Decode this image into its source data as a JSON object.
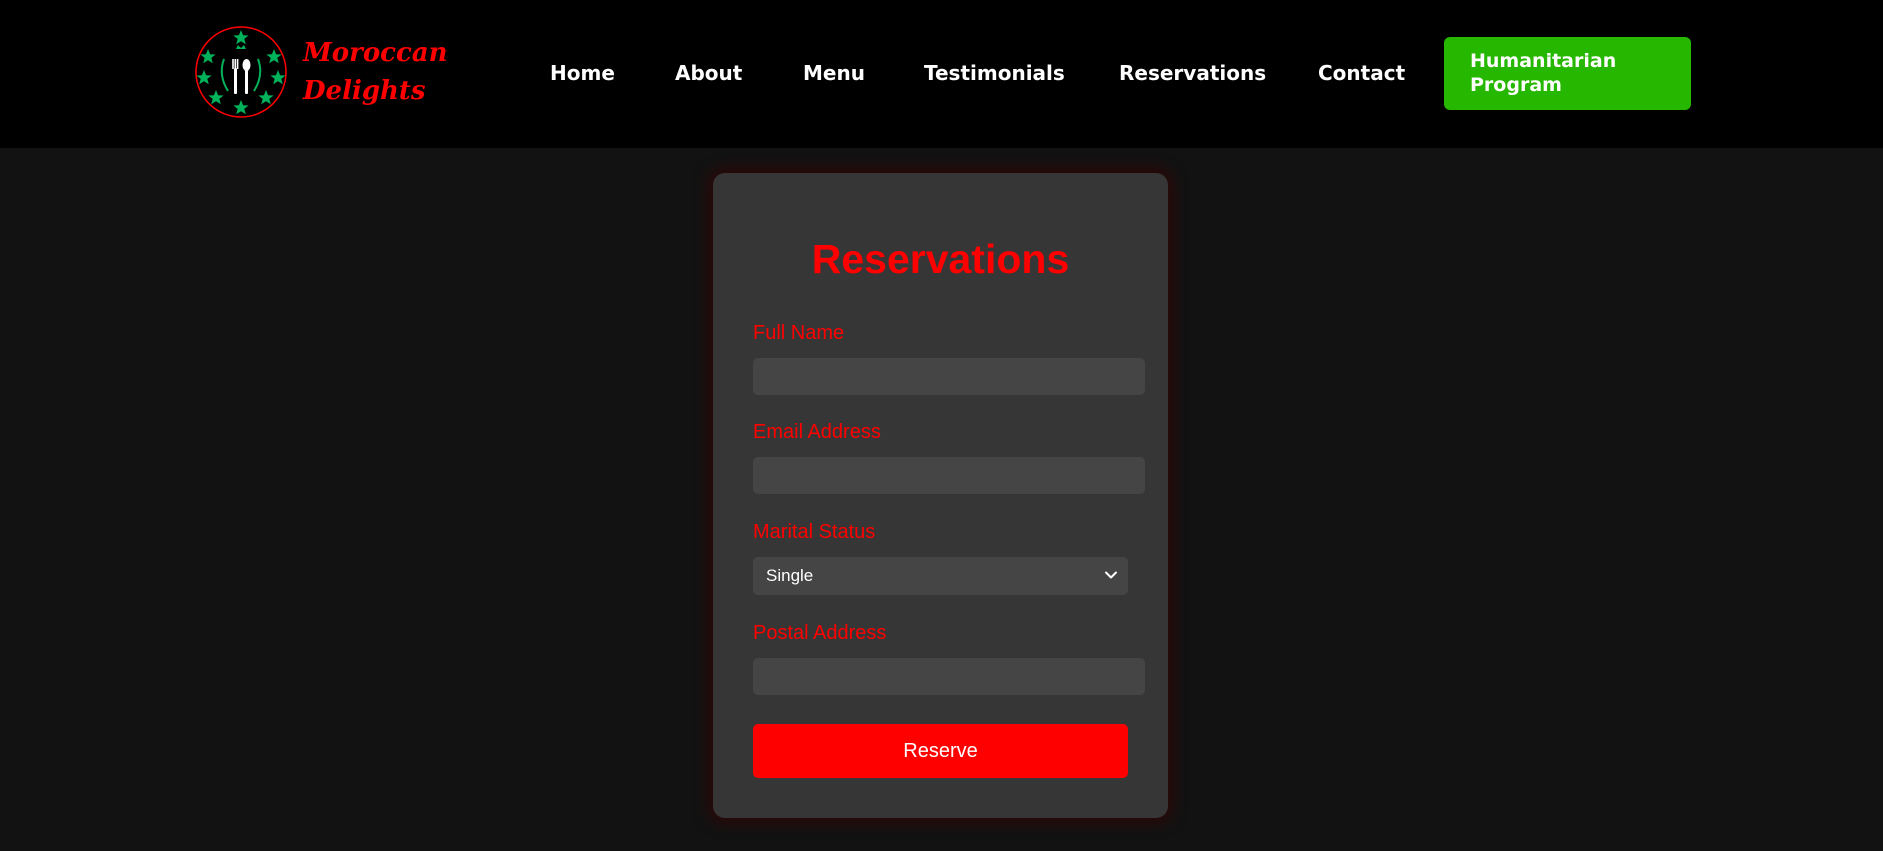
{
  "brand": {
    "line1": "Moroccan",
    "line2": "Delights",
    "color": "#ff0000",
    "logo_icon": "star-wreath-utensils-icon",
    "logo_accent": "#00b35a"
  },
  "nav": {
    "items": [
      {
        "label": "Home"
      },
      {
        "label": "About"
      },
      {
        "label": "Menu"
      },
      {
        "label": "Testimonials"
      },
      {
        "label": "Reservations"
      },
      {
        "label": "Contact"
      }
    ],
    "cta_label": "Humanitarian Program",
    "cta_color": "#26b800"
  },
  "form": {
    "title": "Reservations",
    "full_name_label": "Full Name",
    "full_name_value": "",
    "email_label": "Email Address",
    "email_value": "",
    "marital_label": "Marital Status",
    "marital_selected": "Single",
    "postal_label": "Postal Address",
    "postal_value": "",
    "submit_label": "Reserve",
    "accent": "#ff0000"
  }
}
